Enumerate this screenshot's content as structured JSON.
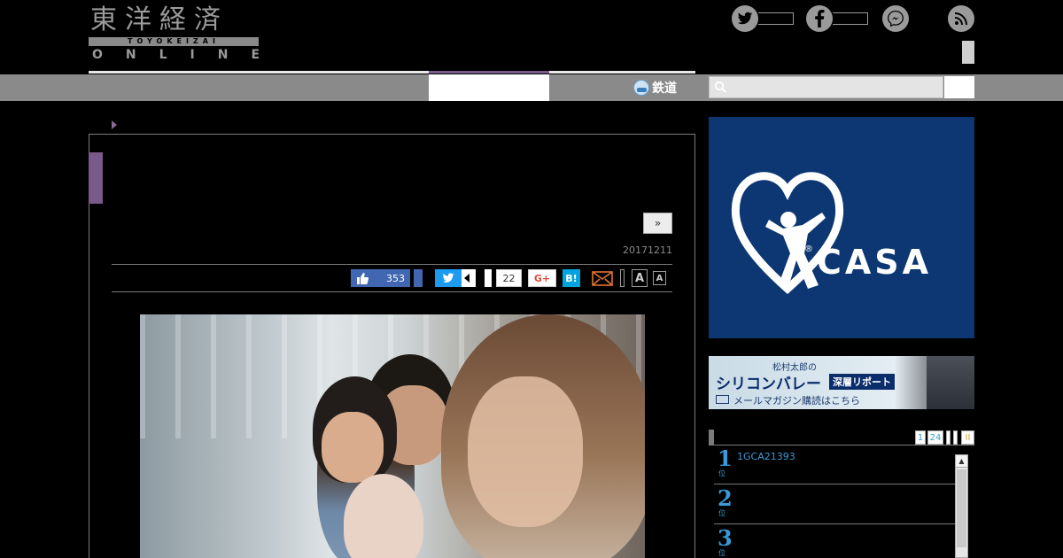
{
  "header": {
    "logo_kanji": "東洋経済",
    "logo_roman": "TOYOKEIZAI",
    "logo_online": "ONLINE",
    "social_icons": [
      "twitter-icon",
      "facebook-icon",
      "messenger-icon",
      "rss-icon"
    ]
  },
  "nav": {
    "rail_label": "鉄道",
    "search_placeholder": ""
  },
  "article": {
    "next_label": "»",
    "date": "20171211",
    "share": {
      "fb_count": "353",
      "hatena_count": "22",
      "gplus_label": "G+",
      "hatena_label": "B!",
      "font_large": "A",
      "font_small": "A"
    }
  },
  "sidebar": {
    "casa_ad": {
      "brand": "CASA",
      "reg": "®"
    },
    "silicon_ad": {
      "small": "松村太郎の",
      "big": "シリコンバレー",
      "tag": "深層リポート",
      "sub": "メールマガジン購読はこちら"
    },
    "ranking": {
      "tabs": [
        "1",
        "24",
        "",
        "",
        "II"
      ],
      "items": [
        {
          "num": "1",
          "sub": "位",
          "text": "1GCA21393"
        },
        {
          "num": "2",
          "sub": "位",
          "text": ""
        },
        {
          "num": "3",
          "sub": "位",
          "text": ""
        }
      ],
      "scroll_up": "▲"
    }
  },
  "colors": {
    "accent_purple": "#7a5a8a",
    "nav_gray": "#8a8a8a",
    "facebook": "#4267b2",
    "twitter": "#1d9bf0",
    "hatena": "#00a4de",
    "casa_blue": "#0c3772",
    "rank_blue": "#3a9ad9"
  }
}
